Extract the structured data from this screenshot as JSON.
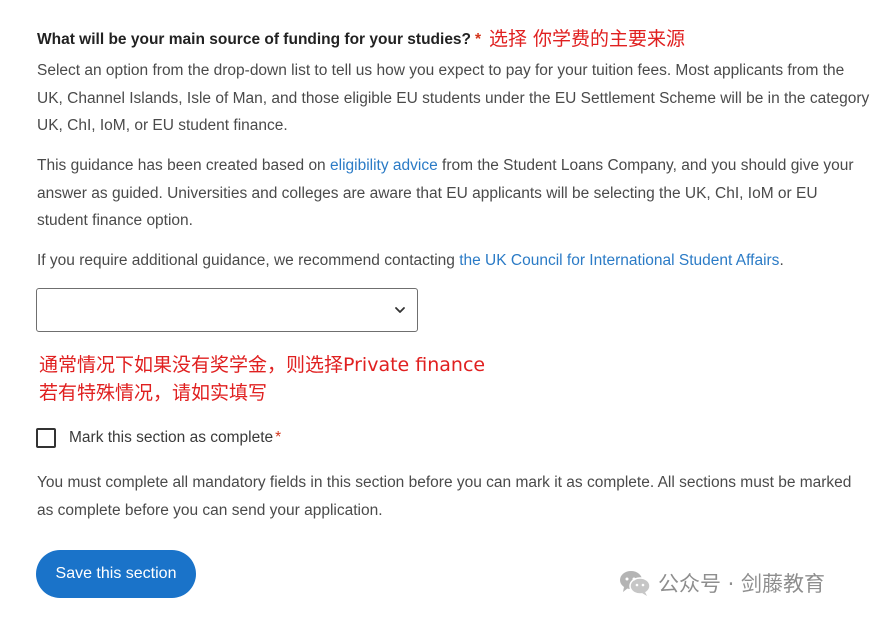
{
  "question": {
    "text": "What will be your main source of funding for your studies?",
    "required_marker": "*"
  },
  "annotations": {
    "top": "选择 你学费的主要来源",
    "mid_line1": "通常情况下如果没有奖学金，则选择Private finance",
    "mid_line2": "若有特殊情况，请如实填写"
  },
  "paragraphs": {
    "p1": "Select an option from the drop-down list to tell us how you expect to pay for your tuition fees. Most applicants from the UK, Channel Islands, Isle of Man, and those eligible EU students under the EU Settlement Scheme will be in the category UK, ChI, IoM, or EU student finance.",
    "p2_before_link": "This guidance has been created based on ",
    "p2_link": "eligibility advice",
    "p2_after_link": " from the Student Loans Company, and you should give your answer as guided. Universities and colleges are aware that EU applicants will be selecting the UK, ChI, IoM or EU student finance option.",
    "p3_before_link": "If you require additional guidance, we recommend contacting ",
    "p3_link": "the UK Council for International Student Affairs",
    "p3_after_link": ".",
    "p4": "You must complete all mandatory fields in this section before you can mark it as complete. All sections must be marked as complete before you can send your application."
  },
  "select": {
    "selected_value": "",
    "icon": "chevron-down-icon"
  },
  "checkbox": {
    "label": "Mark this section as complete",
    "required_marker": "*",
    "checked": false
  },
  "save_button": {
    "label": "Save this section"
  },
  "watermark": {
    "icon": "wechat-icon",
    "text": "公众号 · 剑藤教育"
  },
  "colors": {
    "required": "#d4351c",
    "annotation": "#e02020",
    "link": "#2b7bc6",
    "button": "#1a73c9",
    "body_text": "#4a4a4a"
  }
}
